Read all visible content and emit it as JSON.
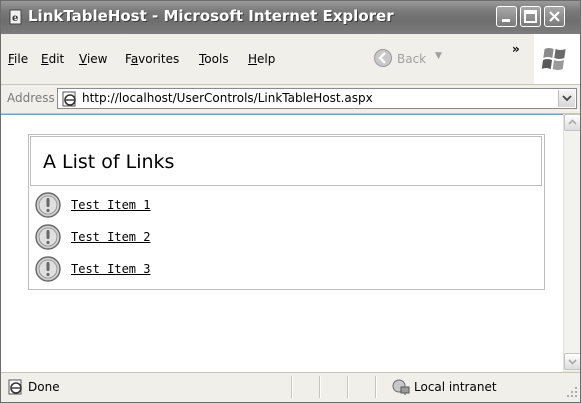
{
  "window": {
    "title": "LinkTableHost - Microsoft Internet Explorer"
  },
  "menubar": {
    "items": [
      {
        "label": "File",
        "accel": "F"
      },
      {
        "label": "Edit",
        "accel": "E"
      },
      {
        "label": "View",
        "accel": "V"
      },
      {
        "label": "Favorites",
        "accel": "a"
      },
      {
        "label": "Tools",
        "accel": "T"
      },
      {
        "label": "Help",
        "accel": "H"
      }
    ],
    "back_label": "Back",
    "overflow_label": "»"
  },
  "address": {
    "label": "Address",
    "url": "http://localhost/UserControls/LinkTableHost.aspx"
  },
  "link_table": {
    "title": "A List of Links",
    "items": [
      {
        "label": "Test Item 1"
      },
      {
        "label": "Test Item 2"
      },
      {
        "label": "Test Item 3"
      }
    ]
  },
  "statusbar": {
    "status": "Done",
    "zone": "Local intranet"
  },
  "icons": {
    "app": "ie-page-icon",
    "back": "back-arrow-icon",
    "address_page": "ie-page-icon",
    "row": "round-info-icon",
    "zone": "local-intranet-icon"
  }
}
